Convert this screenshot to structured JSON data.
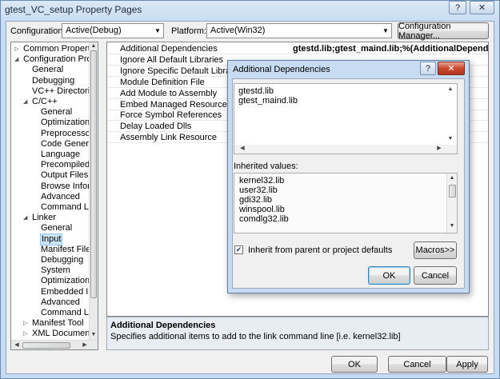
{
  "window": {
    "title": "gtest_VC_setup Property Pages",
    "help_glyph": "?",
    "close_glyph": "✕"
  },
  "toolbar": {
    "configuration_label": "Configuration:",
    "configuration_value": "Active(Debug)",
    "platform_label": "Platform:",
    "platform_value": "Active(Win32)",
    "config_manager_label": "Configuration Manager..."
  },
  "tree": {
    "items": [
      {
        "label": "Common Properties",
        "toggle": "▷"
      },
      {
        "label": "Configuration Proper",
        "toggle": "◢"
      },
      {
        "label": "General"
      },
      {
        "label": "Debugging"
      },
      {
        "label": "VC++ Directories"
      },
      {
        "label": "C/C++",
        "toggle": "◢"
      },
      {
        "label": "General"
      },
      {
        "label": "Optimization"
      },
      {
        "label": "Preprocessor"
      },
      {
        "label": "Code Generatic"
      },
      {
        "label": "Language"
      },
      {
        "label": "Precompiled H"
      },
      {
        "label": "Output Files"
      },
      {
        "label": "Browse Informa"
      },
      {
        "label": "Advanced"
      },
      {
        "label": "Command Line"
      },
      {
        "label": "Linker",
        "toggle": "◢"
      },
      {
        "label": "General"
      },
      {
        "label": "Input"
      },
      {
        "label": "Manifest File"
      },
      {
        "label": "Debugging"
      },
      {
        "label": "System"
      },
      {
        "label": "Optimization"
      },
      {
        "label": "Embedded IDL"
      },
      {
        "label": "Advanced"
      },
      {
        "label": "Command Line"
      },
      {
        "label": "Manifest Tool",
        "toggle": "▷"
      },
      {
        "label": "XML Document Ge",
        "toggle": "▷"
      }
    ]
  },
  "grid": {
    "rows": [
      {
        "name": "Additional Dependencies",
        "value": "gtestd.lib;gtest_maind.lib;%(AdditionalDependencies)"
      },
      {
        "name": "Ignore All Default Libraries",
        "value": ""
      },
      {
        "name": "Ignore Specific Default Libraries",
        "value": ""
      },
      {
        "name": "Module Definition File",
        "value": ""
      },
      {
        "name": "Add Module to Assembly",
        "value": ""
      },
      {
        "name": "Embed Managed Resource File",
        "value": ""
      },
      {
        "name": "Force Symbol References",
        "value": ""
      },
      {
        "name": "Delay Loaded Dlls",
        "value": ""
      },
      {
        "name": "Assembly Link Resource",
        "value": ""
      }
    ]
  },
  "description": {
    "title": "Additional Dependencies",
    "text": "Specifies additional items to add to the link command line [i.e. kernel32.lib]"
  },
  "footer": {
    "ok_label": "OK",
    "cancel_label": "Cancel",
    "apply_label": "Apply"
  },
  "dialog": {
    "title": "Additional Dependencies",
    "help_glyph": "?",
    "close_glyph": "✕",
    "values": [
      "gtestd.lib",
      "gtest_maind.lib"
    ],
    "inherited_label": "Inherited values:",
    "inherited": [
      "kernel32.lib",
      "user32.lib",
      "gdi32.lib",
      "winspool.lib",
      "comdlg32.lib"
    ],
    "inherit_checkbox_label": "Inherit from parent or project defaults",
    "inherit_checked": true,
    "macros_label": "Macros>>",
    "ok_label": "OK",
    "cancel_label": "Cancel"
  }
}
